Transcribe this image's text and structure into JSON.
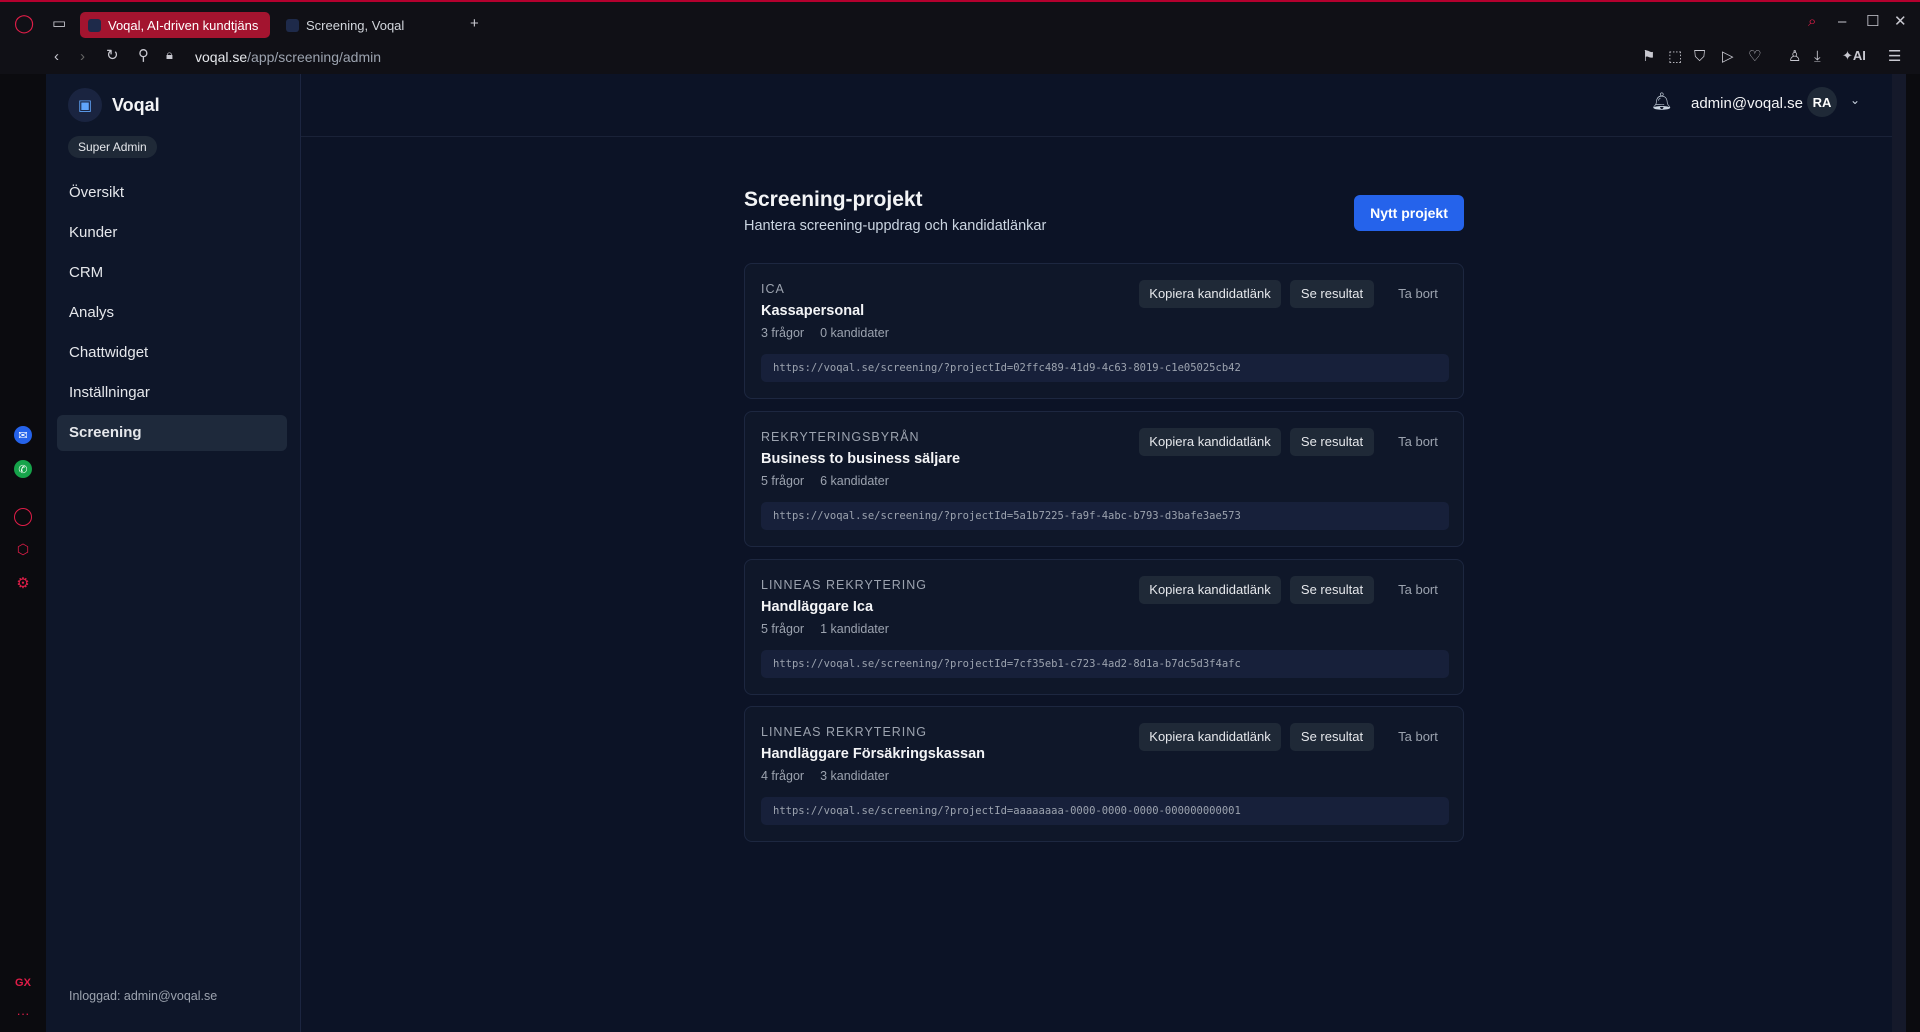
{
  "browser": {
    "tabs": [
      {
        "label": "Voqal, AI-driven kundtjäns"
      },
      {
        "label": "Screening, Voqal"
      }
    ],
    "new_tab_icon": "plus-icon",
    "url_host": "voqal.se",
    "url_path": "/app/screening/admin",
    "accent_color": "#b4002e"
  },
  "sidebar": {
    "brand": "Voqal",
    "role_badge": "Super Admin",
    "items": [
      {
        "label": "Översikt"
      },
      {
        "label": "Kunder"
      },
      {
        "label": "CRM"
      },
      {
        "label": "Analys"
      },
      {
        "label": "Chattwidget"
      },
      {
        "label": "Inställningar"
      },
      {
        "label": "Screening",
        "active": true
      }
    ],
    "footer": "Inloggad: admin@voqal.se"
  },
  "header": {
    "user_email": "admin@voqal.se",
    "avatar_initials": "RA"
  },
  "main": {
    "title": "Screening-projekt",
    "subtitle": "Hantera screening-uppdrag och kandidatlänkar",
    "new_project_label": "Nytt projekt",
    "primary_color": "#2563eb",
    "projects": [
      {
        "client": "ICA",
        "name": "Kassapersonal",
        "questions": "3 frågor",
        "candidates": "0 kandidater",
        "copy_label": "Kopiera kandidatlänk",
        "result_label": "Se resultat",
        "delete_label": "Ta bort",
        "link": "https://voqal.se/screening/?projectId=02ffc489-41d9-4c63-8019-c1e05025cb42"
      },
      {
        "client": "REKRYTERINGSBYRÅN",
        "name": "Business to business säljare",
        "questions": "5 frågor",
        "candidates": "6 kandidater",
        "copy_label": "Kopiera kandidatlänk",
        "result_label": "Se resultat",
        "delete_label": "Ta bort",
        "link": "https://voqal.se/screening/?projectId=5a1b7225-fa9f-4abc-b793-d3bafe3ae573"
      },
      {
        "client": "LINNEAS REKRYTERING",
        "name": "Handläggare Ica",
        "questions": "5 frågor",
        "candidates": "1 kandidater",
        "copy_label": "Kopiera kandidatlänk",
        "result_label": "Se resultat",
        "delete_label": "Ta bort",
        "link": "https://voqal.se/screening/?projectId=7cf35eb1-c723-4ad2-8d1a-b7dc5d3f4afc"
      },
      {
        "client": "LINNEAS REKRYTERING",
        "name": "Handläggare Försäkringskassan",
        "questions": "4 frågor",
        "candidates": "3 kandidater",
        "copy_label": "Kopiera kandidatlänk",
        "result_label": "Se resultat",
        "delete_label": "Ta bort",
        "link": "https://voqal.se/screening/?projectId=aaaaaaaa-0000-0000-0000-000000000001"
      }
    ]
  }
}
